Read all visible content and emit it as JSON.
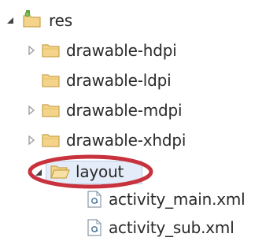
{
  "tree": {
    "root": {
      "label": "res",
      "icon": "resource-folder-icon",
      "state": "expanded"
    },
    "children": [
      {
        "label": "drawable-hdpi",
        "icon": "folder-icon",
        "state": "collapsed"
      },
      {
        "label": "drawable-ldpi",
        "icon": "folder-icon",
        "state": "leaf"
      },
      {
        "label": "drawable-mdpi",
        "icon": "folder-icon",
        "state": "collapsed"
      },
      {
        "label": "drawable-xhdpi",
        "icon": "folder-icon",
        "state": "collapsed"
      },
      {
        "label": "layout",
        "icon": "folder-open-icon",
        "state": "expanded",
        "selected": true,
        "highlighted": true
      }
    ],
    "layout_files": [
      {
        "label": "activity_main.xml",
        "icon": "xml-file-icon"
      },
      {
        "label": "activity_sub.xml",
        "icon": "xml-file-icon"
      }
    ]
  },
  "colors": {
    "highlight_ring": "#c8323c",
    "folder_fill": "#f3d48a",
    "folder_stroke": "#c9a24a",
    "selection": "#e3ecf8"
  }
}
